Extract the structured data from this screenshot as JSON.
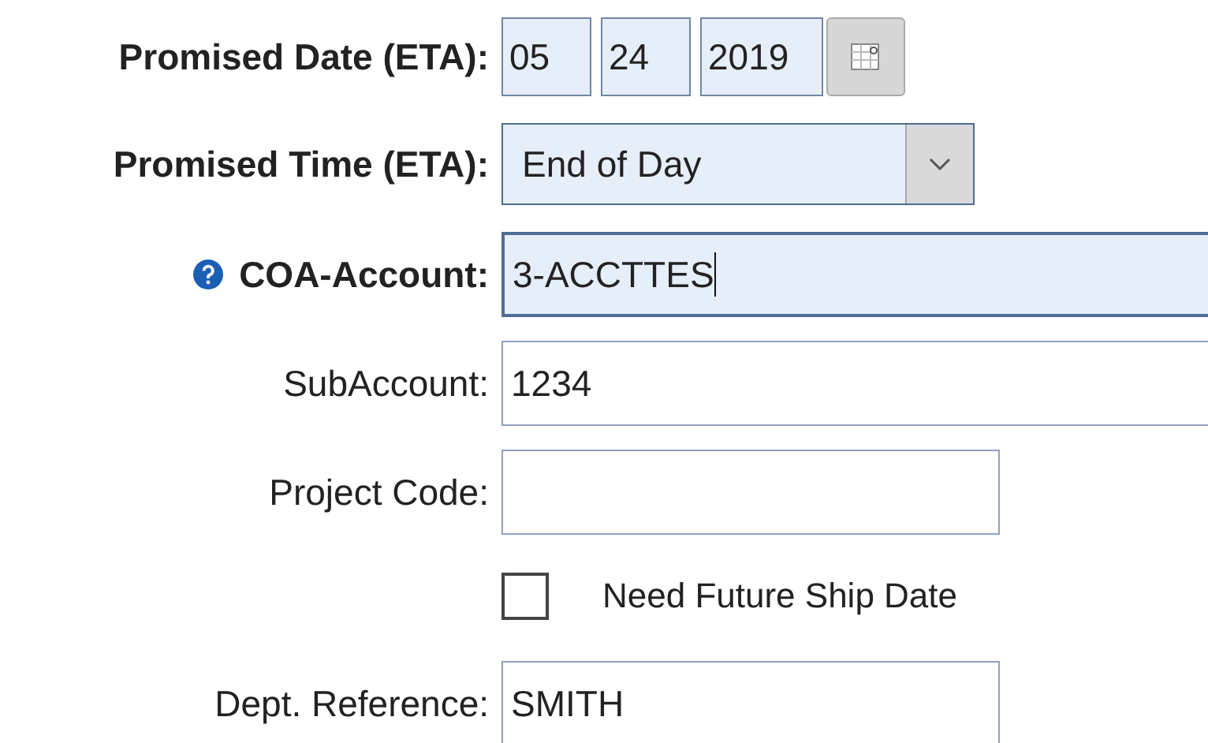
{
  "form": {
    "rows": [
      {
        "kind": "date",
        "label": "Promised Date (ETA):",
        "required": true,
        "help": false,
        "parts": [
          "05",
          "24",
          "2019"
        ]
      },
      {
        "kind": "select",
        "label": "Promised Time (ETA):",
        "required": true,
        "help": false,
        "value": "End of Day"
      },
      {
        "kind": "long_text",
        "label": "COA-Account:",
        "required": true,
        "help": true,
        "value": "3-ACCTTES",
        "focused": true
      },
      {
        "kind": "long_text",
        "label": "SubAccount:",
        "required": false,
        "help": false,
        "value": "1234",
        "focused": false
      },
      {
        "kind": "text",
        "label": "Project Code:",
        "required": false,
        "help": false,
        "value": "",
        "focused": false
      },
      {
        "kind": "checkbox",
        "label": "Need Future Ship Date",
        "checked": false
      },
      {
        "kind": "text",
        "label": "Dept. Reference:",
        "required": false,
        "help": false,
        "value": "SMITH",
        "focused": false
      }
    ]
  }
}
